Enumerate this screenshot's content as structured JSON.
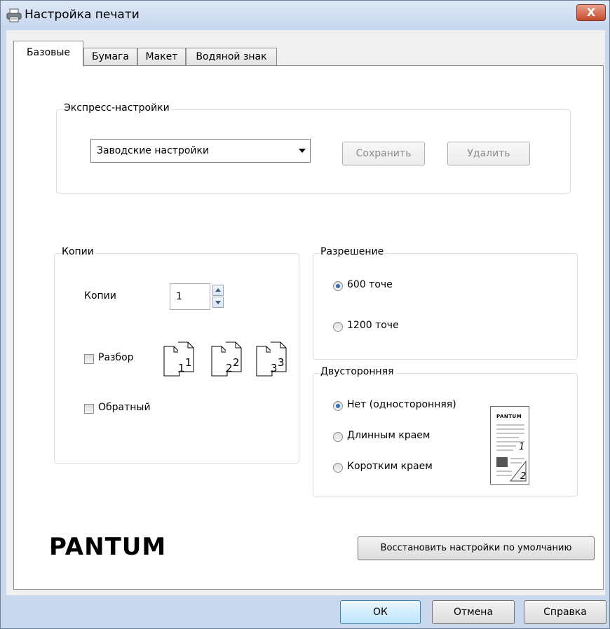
{
  "window": {
    "title": "Настройка печати",
    "close_label": "X"
  },
  "tabs": [
    {
      "label": "Базовые",
      "active": true
    },
    {
      "label": "Бумага",
      "active": false
    },
    {
      "label": "Макет",
      "active": false
    },
    {
      "label": "Водяной знак",
      "active": false
    }
  ],
  "express": {
    "group_label": "Экспресс-настройки",
    "preset_value": "Заводские настройки",
    "save_label": "Сохранить",
    "delete_label": "Удалить"
  },
  "copies": {
    "group_label": "Копии",
    "copies_label": "Копии",
    "copies_value": "1",
    "collate_label": "Разбор",
    "collate_checked": false,
    "reverse_label": "Обратный",
    "reverse_checked": false,
    "collate_pages": [
      "1",
      "1",
      "2",
      "2",
      "3",
      "3"
    ]
  },
  "resolution": {
    "group_label": "Разрешение",
    "options": [
      {
        "label": "600 точе",
        "selected": true
      },
      {
        "label": "1200 точе",
        "selected": false
      }
    ]
  },
  "duplex": {
    "group_label": "Двусторонняя",
    "options": [
      {
        "label": "Нет (односторонняя)",
        "selected": true
      },
      {
        "label": "Длинным краем",
        "selected": false
      },
      {
        "label": "Коротким краем",
        "selected": false
      }
    ],
    "preview_brand": "PANTUM",
    "preview_page_1": "1",
    "preview_page_2": "2"
  },
  "brand": {
    "logo_text": "PANTUM"
  },
  "restore_label": "Восстановить настройки по умолчанию",
  "footer": {
    "ok_label": "ОК",
    "cancel_label": "Отмена",
    "help_label": "Справка"
  },
  "colors": {
    "titlebar": "#c5d6ee",
    "close": "#c54a2c",
    "radio_selected": "#2a6fc1",
    "default_button": "#bee6fd"
  }
}
